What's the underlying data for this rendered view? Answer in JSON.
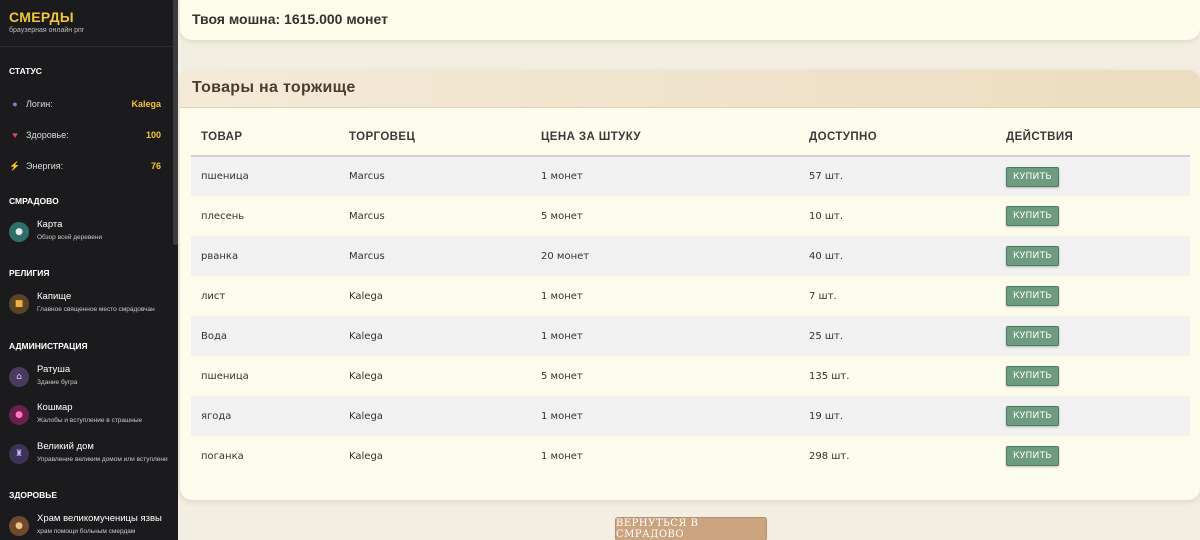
{
  "brand": {
    "title": "СМЕРДЫ",
    "subtitle": "браузерная онлайн рпг"
  },
  "sidebar": {
    "status_heading": "СТАТУС",
    "stats": [
      {
        "label": "Логин:",
        "value": "Kalega",
        "icon": "user-icon"
      },
      {
        "label": "Здоровье:",
        "value": "100",
        "icon": "heart-icon"
      },
      {
        "label": "Энергия:",
        "value": "76",
        "icon": "lightning-icon"
      }
    ],
    "sections": [
      {
        "heading": "СМРАДОВО",
        "items": [
          {
            "title": "Карта",
            "subtitle": "Обзор всей деревени",
            "icon": "globe-icon"
          }
        ]
      },
      {
        "heading": "РЕЛИГИЯ",
        "items": [
          {
            "title": "Капище",
            "subtitle": "Главное священное место смрадовчан",
            "icon": "idol-icon"
          }
        ]
      },
      {
        "heading": "АДМИНИСТРАЦИЯ",
        "items": [
          {
            "title": "Ратуша",
            "subtitle": "Здание бугра",
            "icon": "house-icon"
          },
          {
            "title": "Кошмар",
            "subtitle": "Жалобы и вступление в страшные",
            "icon": "demon-icon"
          },
          {
            "title": "Великий дом",
            "subtitle": "Управление великим домом или вступлени",
            "icon": "castle-icon"
          }
        ]
      },
      {
        "heading": "ЗДОРОВЬЕ",
        "items": [
          {
            "title": "Храм великомученицы язвы",
            "subtitle": "храм помощи больным смердам",
            "icon": "monkey-icon"
          }
        ]
      }
    ]
  },
  "money": {
    "text": "Твоя мошна: 1615.000 монет"
  },
  "market": {
    "title": "Товары на торжище",
    "columns": [
      "ТОВАР",
      "ТОРГОВЕЦ",
      "ЦЕНА ЗА ШТУКУ",
      "ДОСТУПНО",
      "ДЕЙСТВИЯ"
    ],
    "rows": [
      {
        "item": "пшеница",
        "seller": "Marcus",
        "price": "1 монет",
        "available": "57 шт.",
        "action": "КУПИТЬ"
      },
      {
        "item": "плесень",
        "seller": "Marcus",
        "price": "5 монет",
        "available": "10 шт.",
        "action": "КУПИТЬ"
      },
      {
        "item": "рванка",
        "seller": "Marcus",
        "price": "20 монет",
        "available": "40 шт.",
        "action": "КУПИТЬ"
      },
      {
        "item": "лист",
        "seller": "Kalega",
        "price": "1 монет",
        "available": "7 шт.",
        "action": "КУПИТЬ"
      },
      {
        "item": "Вода",
        "seller": "Kalega",
        "price": "1 монет",
        "available": "25 шт.",
        "action": "КУПИТЬ"
      },
      {
        "item": "пшеница",
        "seller": "Kalega",
        "price": "5 монет",
        "available": "135 шт.",
        "action": "КУПИТЬ"
      },
      {
        "item": "ягода",
        "seller": "Kalega",
        "price": "1 монет",
        "available": "19 шт.",
        "action": "КУПИТЬ"
      },
      {
        "item": "поганка",
        "seller": "Kalega",
        "price": "1 монет",
        "available": "298 шт.",
        "action": "КУПИТЬ"
      }
    ]
  },
  "back_button": {
    "label": "ВЕРНУТЬСЯ В СМРАДОВО"
  }
}
